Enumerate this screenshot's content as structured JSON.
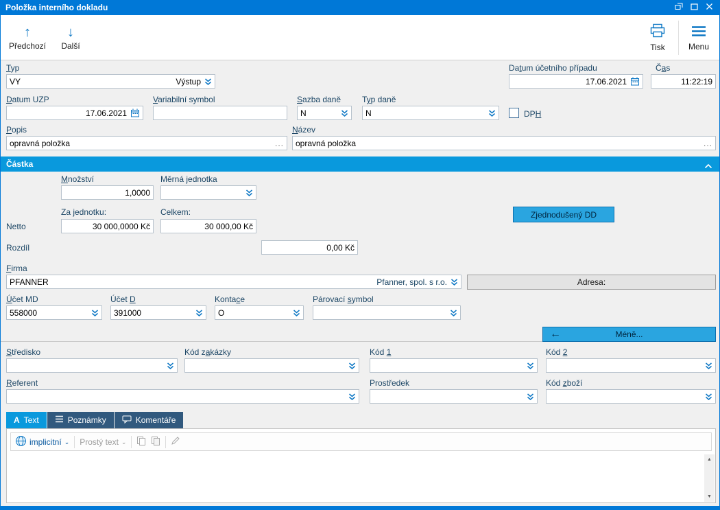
{
  "window": {
    "title": "Položka interního dokladu"
  },
  "toolbar": {
    "prev_label": "Předchozí",
    "next_label": "Další",
    "print_label": "Tisk",
    "menu_label": "Menu"
  },
  "form": {
    "typ": {
      "label": {
        "text": "Typ",
        "u": 0
      },
      "code": "VY",
      "name": "Výstup"
    },
    "datum_ucetniho_pripadu": {
      "label": {
        "text": "Datum účetního případu",
        "u": 2
      },
      "value": "17.06.2021"
    },
    "cas": {
      "label": {
        "text": "Čas",
        "u": 1
      },
      "value": "11:22:19"
    },
    "datum_uzp": {
      "label": {
        "text": "Datum UZP",
        "u": 0
      },
      "value": "17.06.2021"
    },
    "variabilni_symbol": {
      "label": {
        "text": "Variabilní symbol",
        "u": 0
      },
      "value": ""
    },
    "sazba_dane": {
      "label": {
        "text": "Sazba daně",
        "u": 0
      },
      "value": "N"
    },
    "typ_dane": {
      "label": {
        "text": "Typ daně",
        "u": 1
      },
      "value": "N"
    },
    "dph": {
      "label": {
        "text": "DPH",
        "u": 2
      },
      "checked": false
    },
    "popis": {
      "label": {
        "text": "Popis",
        "u": 0
      },
      "value": "opravná položka"
    },
    "nazev": {
      "label": {
        "text": "Název",
        "u": 0
      },
      "value": "opravná položka"
    }
  },
  "castka": {
    "header": "Částka",
    "mnozstvi": {
      "label": {
        "text": "Množství",
        "u": 0
      },
      "value": "1,0000"
    },
    "merna_jednotka": {
      "label": {
        "text": "Měrná jednotka",
        "u": 6
      },
      "value": ""
    },
    "za_jednotku_label": "Za jednotku:",
    "celkem_label": "Celkem:",
    "zjednoduseny_dd_label": "Zjednodušený DD",
    "netto_label": "Netto",
    "netto_za_jednotku": "30 000,0000 Kč",
    "netto_celkem": "30 000,00 Kč",
    "rozdil_label": "Rozdíl",
    "rozdil_value": "0,00 Kč"
  },
  "firma": {
    "label": {
      "text": "Firma",
      "u": 0
    },
    "code": "PFANNER",
    "name": "Pfanner, spol. s r.o.",
    "adresa_label": "Adresa:"
  },
  "accounts": {
    "ucet_md": {
      "label": {
        "text": "Účet MD",
        "u": 0
      },
      "value": "558000"
    },
    "ucet_d": {
      "label": {
        "text": "Účet D",
        "u": 5
      },
      "value": "391000"
    },
    "kontace": {
      "label": {
        "text": "Kontace",
        "u": 5
      },
      "value": "O"
    },
    "parovaci_symbol": {
      "label": {
        "text": "Párovací symbol",
        "u": 9
      },
      "value": ""
    }
  },
  "mene": {
    "label": "Méně..."
  },
  "extra": {
    "stredisko": {
      "label": {
        "text": "Středisko",
        "u": 0
      },
      "value": ""
    },
    "kod_zakazky": {
      "label": {
        "text": "Kód zakázky",
        "u": 5
      },
      "value": ""
    },
    "kod_1": {
      "label": {
        "text": "Kód 1",
        "u": 4
      },
      "value": ""
    },
    "kod_2": {
      "label": {
        "text": "Kód 2",
        "u": 4
      },
      "value": ""
    },
    "referent": {
      "label": {
        "text": "Referent",
        "u": 0
      },
      "value": ""
    },
    "prostredek": {
      "label": {
        "text": "Prostředek",
        "u": -1
      },
      "value": ""
    },
    "kod_zbozi": {
      "label": {
        "text": "Kód zboží",
        "u": 4
      },
      "value": ""
    }
  },
  "tabs": [
    {
      "label": "Text",
      "active": true
    },
    {
      "label": "Poznámky",
      "active": false
    },
    {
      "label": "Komentáře",
      "active": false
    }
  ],
  "editor": {
    "language": "implicitní",
    "format": "Prostý text",
    "content": ""
  },
  "icons": {
    "prev_arrow": "↑",
    "next_arrow": "↓",
    "mene_arrow": "←",
    "ellipsis": "...",
    "caret_down": "⌄",
    "scroll_up": "▲",
    "scroll_down": "▼",
    "text_tab_glyph": "A"
  },
  "colors": {
    "titlebar": "#0078d7",
    "section_header": "#0999dd",
    "accent_icon": "#0b76c4",
    "cyan_button": "#2aa5e0",
    "inactive_tab": "#31597e",
    "form_background": "#f0f0f0"
  }
}
